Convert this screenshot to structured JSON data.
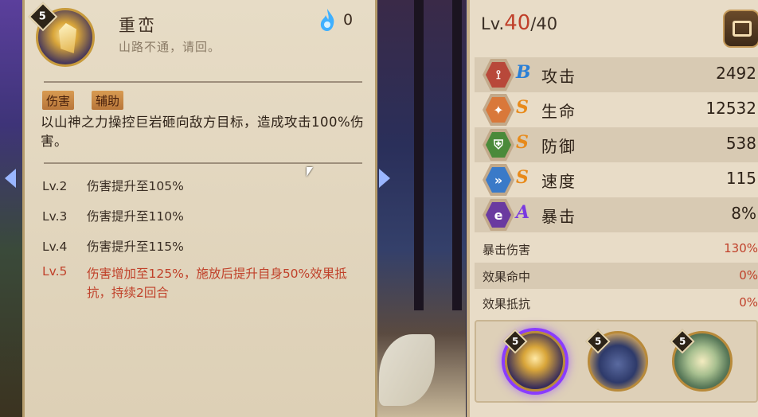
{
  "skill": {
    "level": "5",
    "name": "重峦",
    "quote": "山路不通，请回。",
    "cost": "0",
    "tags": [
      "伤害",
      "辅助"
    ],
    "description": "以山神之力操控巨岩砸向敌方目标，造成攻击100%伤害。",
    "upgrades": [
      {
        "lv": "Lv.2",
        "text": "伤害提升至105%"
      },
      {
        "lv": "Lv.3",
        "text": "伤害提升至110%"
      },
      {
        "lv": "Lv.4",
        "text": "伤害提升至115%"
      },
      {
        "lv": "Lv.5",
        "text": "伤害增加至125%，施放后提升自身50%效果抵抗，持续2回合"
      }
    ]
  },
  "shikigami": {
    "level_prefix": "Lv.",
    "level_current": "40",
    "level_max": "/40",
    "stats": [
      {
        "icon": "fan-icon",
        "grade": "B",
        "name": "攻击",
        "value": "2492"
      },
      {
        "icon": "talisman-icon",
        "grade": "S",
        "name": "生命",
        "value": "12532"
      },
      {
        "icon": "helmet-icon",
        "grade": "S",
        "name": "防御",
        "value": "538"
      },
      {
        "icon": "chevron-speed-icon",
        "grade": "S",
        "name": "速度",
        "value": "115"
      },
      {
        "icon": "scroll-crit-icon",
        "grade": "A",
        "name": "暴击",
        "value": "8%"
      }
    ],
    "sub_stats": [
      {
        "name": "暴击伤害",
        "value": "130%"
      },
      {
        "name": "效果命中",
        "value": "0%"
      },
      {
        "name": "效果抵抗",
        "value": "0%"
      }
    ],
    "skill_slots": [
      {
        "level": "5",
        "icon": "rock-skill-icon"
      },
      {
        "level": "5",
        "icon": "stone-pillar-skill-icon"
      },
      {
        "level": "5",
        "icon": "mountain-skill-icon"
      }
    ]
  },
  "colors": {
    "panel_bg": "#e7dcc6",
    "highlight_red": "#c0412a",
    "grade_b": "#2a7fd6",
    "grade_s": "#e88a1a",
    "grade_a": "#7a3ae0",
    "active_glow": "#8a3cff"
  }
}
